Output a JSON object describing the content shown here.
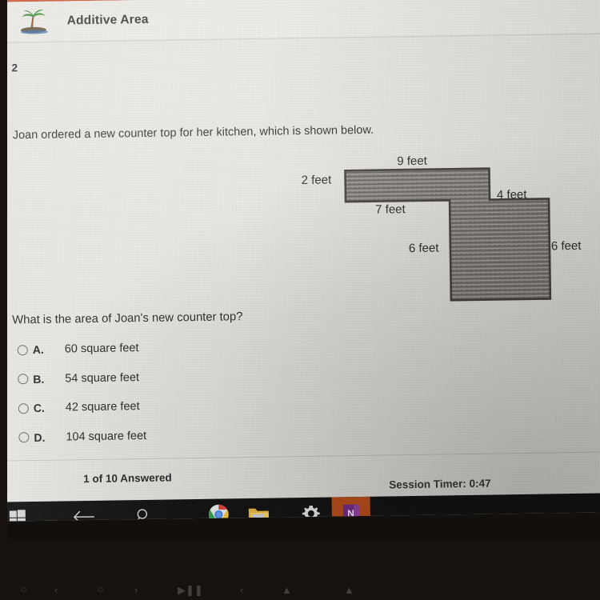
{
  "header": {
    "logo_icon": "palm-tree-island-icon",
    "title": "Additive Area",
    "accent_color": "#c85634"
  },
  "question": {
    "number": "2",
    "stem": "Joan ordered a new counter top for her kitchen, which is shown below.",
    "prompt": "What is the area of Joan's new counter top?"
  },
  "figure": {
    "shape": "z-shaped counter top",
    "labels": [
      {
        "text": "2 feet",
        "name": "dim-left-2ft"
      },
      {
        "text": "9 feet",
        "name": "dim-top-9ft"
      },
      {
        "text": "7 feet",
        "name": "dim-under-7ft"
      },
      {
        "text": "4 feet",
        "name": "dim-top-right-4ft"
      },
      {
        "text": "6 feet",
        "name": "dim-inner-left-6ft"
      },
      {
        "text": "6 feet",
        "name": "dim-right-6ft"
      }
    ]
  },
  "choices": [
    {
      "letter": "A.",
      "text": "60 square feet",
      "selected": false
    },
    {
      "letter": "B.",
      "text": "54 square feet",
      "selected": false
    },
    {
      "letter": "C.",
      "text": "42 square feet",
      "selected": false
    },
    {
      "letter": "D.",
      "text": "104 square feet",
      "selected": false
    }
  ],
  "footer": {
    "answered": "1 of 10 Answered",
    "timer": "Session Timer: 0:47"
  },
  "taskbar": {
    "items": [
      {
        "name": "start-button",
        "icon": "windows-logo-icon",
        "active": false
      },
      {
        "name": "back-button",
        "icon": "back-arrow-icon",
        "active": false
      },
      {
        "name": "search-button",
        "icon": "search-icon",
        "active": false
      },
      {
        "name": "chrome-button",
        "icon": "chrome-icon",
        "active": true
      },
      {
        "name": "explorer-button",
        "icon": "folder-icon",
        "active": false
      },
      {
        "name": "settings-button",
        "icon": "gear-icon",
        "active": true
      },
      {
        "name": "onenote-button",
        "icon": "onenote-icon",
        "active": false
      }
    ]
  }
}
